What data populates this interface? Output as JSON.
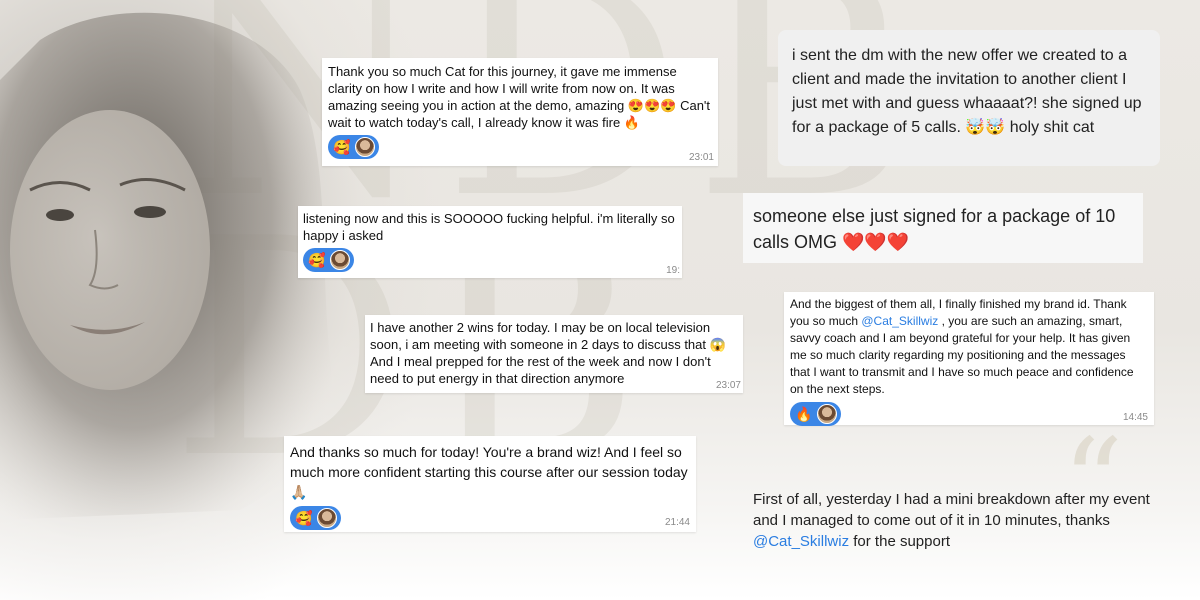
{
  "messages": [
    {
      "id": "card1",
      "text": "Thank you so much Cat for this journey, it gave me immense clarity on how I write and how I will write from now on. It was amazing seeing you in action at the demo, amazing 😍😍😍 Can't wait to watch today's call, I already know it was fire 🔥",
      "reactions": [
        "🥰"
      ],
      "time": "23:01"
    },
    {
      "id": "card2",
      "text": "listening now and this is SOOOOO fucking helpful. i'm literally so happy i asked",
      "reactions": [
        "🥰"
      ],
      "time": "19:"
    },
    {
      "id": "card3",
      "text": "I have another 2 wins for today. I may be on local television soon, i am meeting with someone in 2 days to discuss that 😱 And I meal prepped for the rest of the week and now I don't need to put energy in that direction anymore",
      "time": "23:07"
    },
    {
      "id": "card4",
      "text": "And thanks so much for today! You're a brand wiz! And I feel so much more confident starting this course after our session today 🙏🏼",
      "reactions": [
        "🥰"
      ],
      "time": "21:44"
    },
    {
      "id": "card5",
      "text": "i sent the dm with the new offer we created to a client and made the invitation to another client I just met with and guess whaaaat?! she signed up for a package of 5 calls. 🤯🤯 holy shit cat"
    },
    {
      "id": "card6",
      "text": "someone else just signed for a package of 10 calls OMG ❤️❤️❤️"
    },
    {
      "id": "card7",
      "text_before": "And the biggest of them all, I finally finished my brand id. Thank you so much ",
      "mention": "@Cat_Skillwiz",
      "text_after": " , you are such an amazing, smart, savvy coach and I am beyond grateful for your help. It has given me so much clarity regarding my positioning and the messages that I want to transmit and I have so much peace and confidence on the next steps.",
      "reactions": [
        "🔥"
      ],
      "time": "14:45"
    }
  ],
  "quote": {
    "text_before": "First of all, yesterday I had a mini breakdown after my event and I managed to come out of it in 10 minutes, thanks ",
    "mention": "@Cat_Skillwiz",
    "text_after": " for the support"
  },
  "icons": {
    "quote_mark": "quote-icon",
    "avatar": "avatar"
  },
  "colors": {
    "reaction_bg": "#3b86e6",
    "mention": "#2a7de1"
  }
}
